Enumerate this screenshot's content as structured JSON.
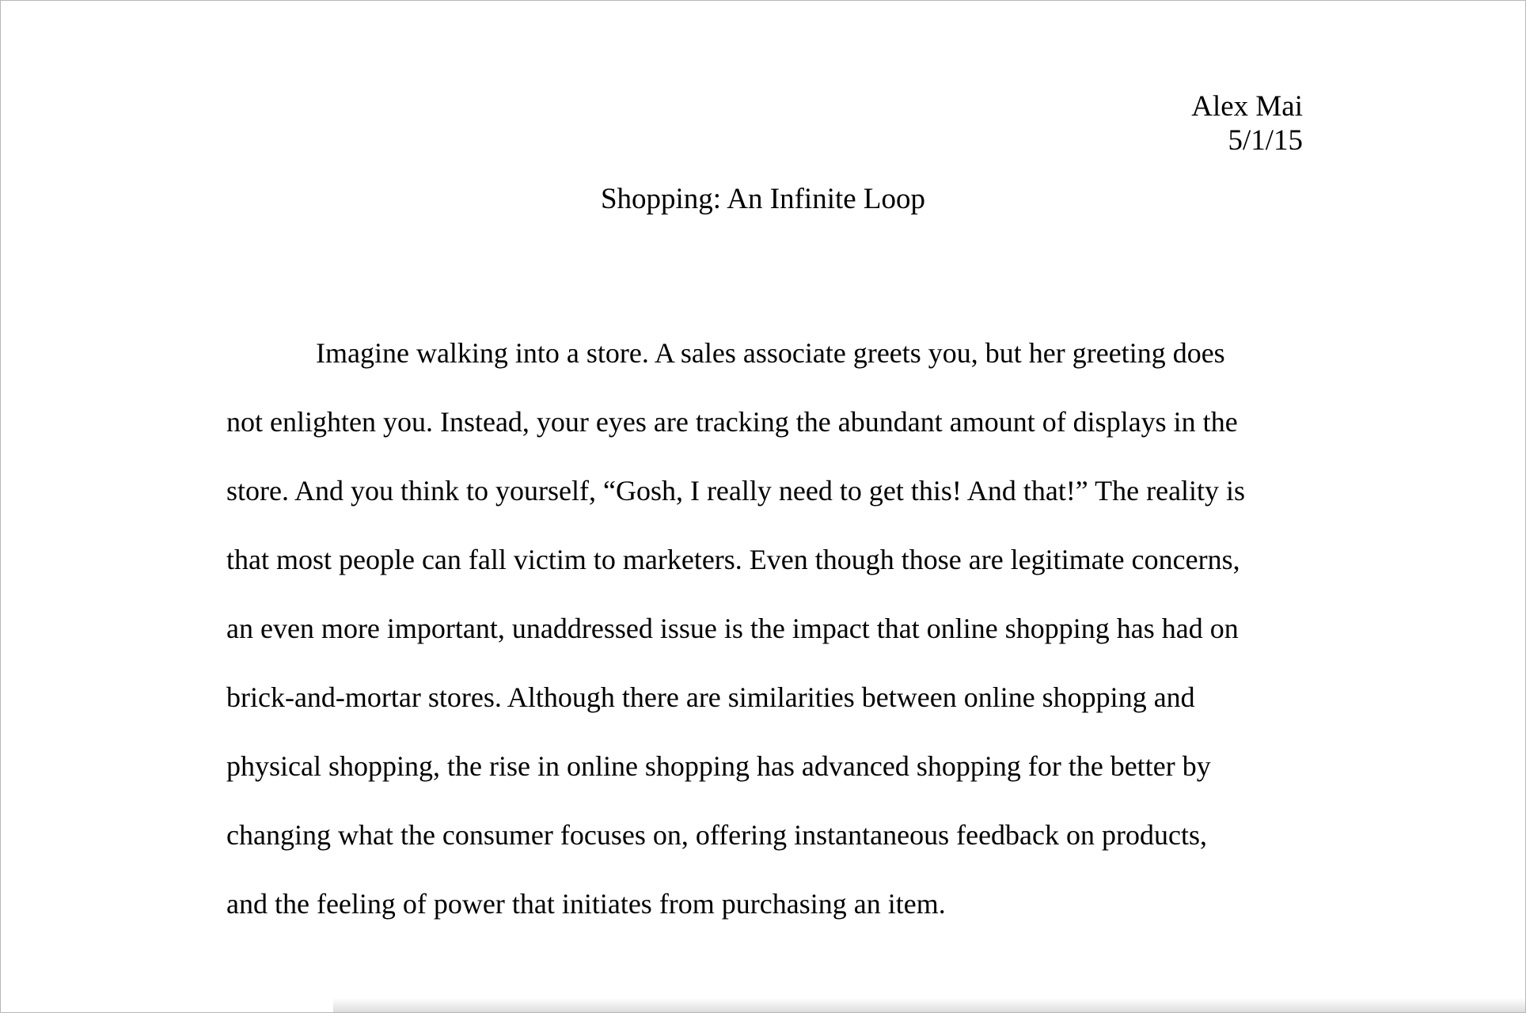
{
  "header": {
    "author": "Alex Mai",
    "date": "5/1/15"
  },
  "title": "Shopping: An Infinite Loop",
  "body": {
    "lines": [
      "Imagine walking into a store. A sales associate greets you, but her greeting does",
      "not enlighten you. Instead, your eyes are tracking the abundant amount of displays in the",
      "store. And you think to yourself, “Gosh, I really need to get this! And that!” The reality is",
      "that most people can fall victim to marketers. Even though those are legitimate concerns,",
      "an even more important, unaddressed issue is the impact that online shopping has had on",
      "brick-and-mortar stores. Although there are similarities between online shopping and",
      "physical shopping, the rise in online shopping has advanced shopping for the better by",
      "changing what the consumer focuses on, offering instantaneous feedback on products,",
      "and the feeling of power that initiates from purchasing an item."
    ]
  }
}
